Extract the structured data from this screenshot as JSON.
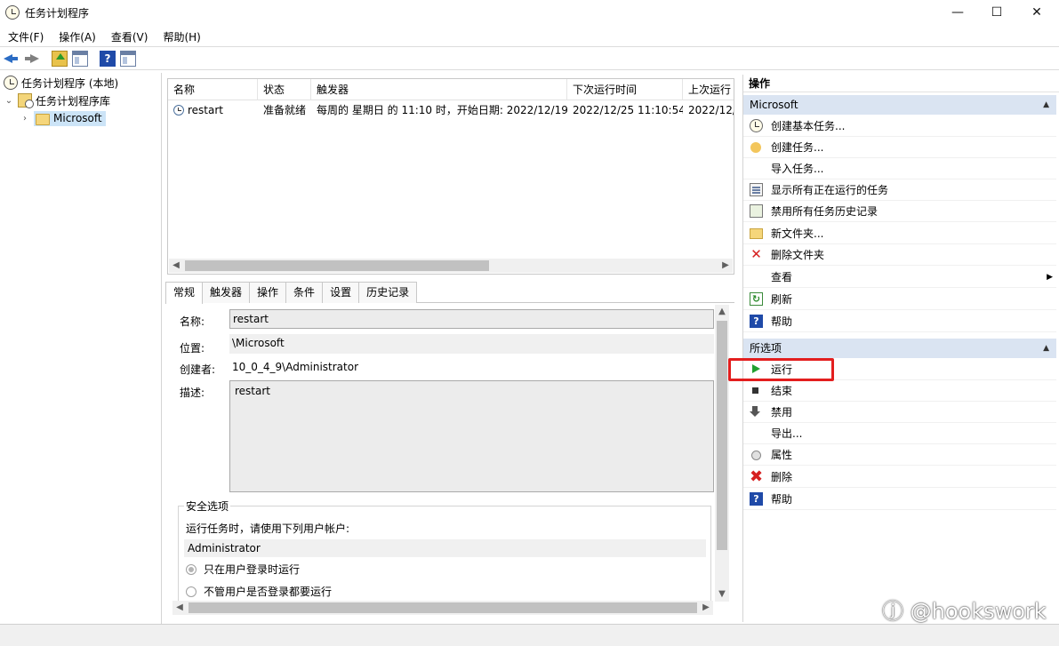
{
  "window": {
    "title": "任务计划程序",
    "controls": {
      "minimize": "—",
      "maximize": "☐",
      "close": "✕"
    }
  },
  "menu": [
    "文件(F)",
    "操作(A)",
    "查看(V)",
    "帮助(H)"
  ],
  "toolbar": {
    "help_glyph": "?"
  },
  "tree": {
    "root": "任务计划程序 (本地)",
    "library": "任务计划程序库",
    "folder": "Microsoft"
  },
  "task_list": {
    "columns": [
      "名称",
      "状态",
      "触发器",
      "下次运行时间",
      "上次运行"
    ],
    "rows": [
      {
        "name": "restart",
        "status": "准备就绪",
        "trigger": "每周的 星期日 的 11:10 时，开始日期: 2022/12/19",
        "next_run": "2022/12/25 11:10:54",
        "last_run": "2022/12/"
      }
    ]
  },
  "tabs": [
    "常规",
    "触发器",
    "操作",
    "条件",
    "设置",
    "历史记录"
  ],
  "general": {
    "name_label": "名称:",
    "name_value": "restart",
    "location_label": "位置:",
    "location_value": "\\Microsoft",
    "author_label": "创建者:",
    "author_value": "10_0_4_9\\Administrator",
    "desc_label": "描述:",
    "desc_value": "restart",
    "security_title": "安全选项",
    "run_as_prompt": "运行任务时，请使用下列用户帐户:",
    "run_as_user": "Administrator",
    "option_logged_on": "只在用户登录时运行",
    "option_any": "不管用户是否登录都要运行"
  },
  "actions_pane": {
    "title": "操作",
    "section1": "Microsoft",
    "section1_items": [
      "创建基本任务...",
      "创建任务...",
      "导入任务...",
      "显示所有正在运行的任务",
      "禁用所有任务历史记录",
      "新文件夹...",
      "删除文件夹",
      "查看",
      "刷新",
      "帮助"
    ],
    "section2": "所选项",
    "section2_items": [
      "运行",
      "结束",
      "禁用",
      "导出...",
      "属性",
      "删除",
      "帮助"
    ]
  },
  "watermark": "ⓙ @hookswork",
  "colors": {
    "section_header": "#dae4f2",
    "selection": "#cce4f7",
    "highlight": "#e31e1e"
  }
}
